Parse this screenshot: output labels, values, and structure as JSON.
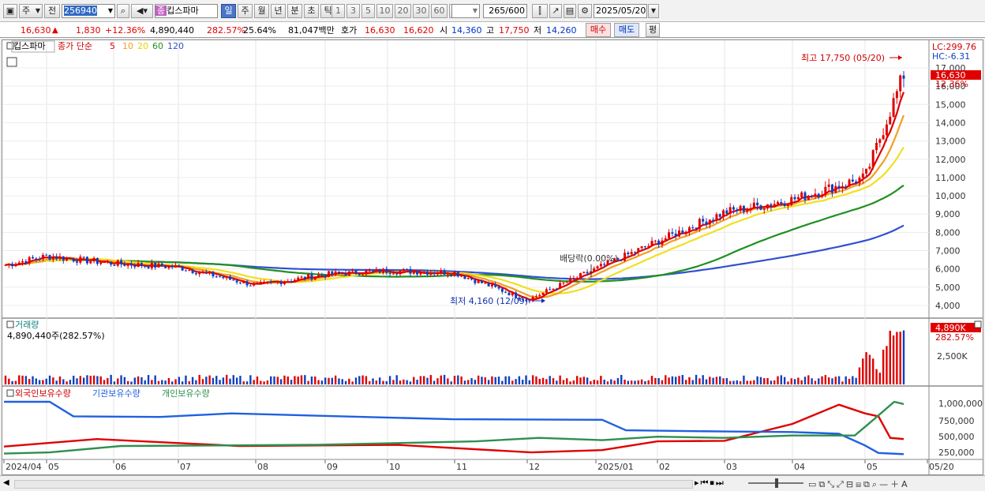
{
  "toolbar": {
    "type_label": "주",
    "scope_label": "전",
    "code": "256940",
    "name_badge": "종",
    "name": "킵스파마",
    "periods": [
      "일",
      "주",
      "월",
      "년",
      "분",
      "초",
      "틱"
    ],
    "intervals": [
      "1",
      "3",
      "5",
      "10",
      "20",
      "30",
      "60",
      "120"
    ],
    "count": "265",
    "count_total": "/600",
    "date": "2025/05/20"
  },
  "quote": {
    "price": "16,630",
    "arrow": "▲",
    "change": "1,830",
    "change_pct": "+12.36%",
    "volume": "4,890,440",
    "vol_ratio": "282.57%",
    "turnover": "25.64%",
    "amount": "81,047백만",
    "hoga_label": "호가",
    "ask": "16,630",
    "bid": "16,620",
    "open_label": "시",
    "open": "14,360",
    "high_label": "고",
    "high": "17,750",
    "low_label": "저",
    "low": "14,260",
    "buy_label": "매수",
    "sell_label": "매도",
    "eval_label": "평"
  },
  "price_panel": {
    "name": "킵스파마",
    "legend_prefix": "종가 단순",
    "ma_periods": [
      "5",
      "10",
      "20",
      "60",
      "120"
    ],
    "lc_label": "LC:299.76",
    "hc_label": "HC:-6.31",
    "current_price_tag": "16,630",
    "current_pct_tag": "12.36%",
    "annot_high": "최고 17,750 (05/20)",
    "annot_low": "최저 4,160 (12/09)",
    "annot_div": "배당락(0.00%)"
  },
  "volume_panel": {
    "title": "거래량",
    "value_text": "4,890,440주(282.57%)",
    "tag_value": "4,890K",
    "tag_pct": "282.57%",
    "tick_label": "2,500K"
  },
  "holdings_panel": {
    "legend": [
      "외국인보유수량",
      "기관보유수량",
      "개인보유수량"
    ],
    "ticks": [
      "1,000,000",
      "750,000",
      "500,000",
      "250,000"
    ]
  },
  "x_axis": [
    "2024/04",
    "05",
    "06",
    "07",
    "08",
    "09",
    "10",
    "11",
    "12",
    "2025/01",
    "02",
    "03",
    "04",
    "05",
    "05/20"
  ],
  "chart_data": {
    "type": "line",
    "price_axis": {
      "ticks": [
        4000,
        5000,
        6000,
        7000,
        8000,
        9000,
        10000,
        11000,
        12000,
        13000,
        14000,
        15000,
        16000,
        17000
      ]
    },
    "price_series": [
      {
        "x": "2024/04",
        "close": 6200
      },
      {
        "x": "05",
        "close": 6700
      },
      {
        "x": "06",
        "close": 6300
      },
      {
        "x": "07",
        "close": 6100
      },
      {
        "x": "08",
        "close": 5100
      },
      {
        "x": "09",
        "close": 5700
      },
      {
        "x": "10",
        "close": 5900
      },
      {
        "x": "11",
        "close": 5800
      },
      {
        "x": "12",
        "close": 4300
      },
      {
        "x": "2025/01",
        "close": 6000
      },
      {
        "x": "02",
        "close": 7500
      },
      {
        "x": "03",
        "close": 9100
      },
      {
        "x": "04",
        "close": 9800
      },
      {
        "x": "05",
        "close": 11000
      },
      {
        "x": "05/20",
        "close": 16630
      }
    ],
    "volume_axis": {
      "ticks": [
        2500
      ]
    },
    "holdings_axis": {
      "ticks": [
        250000,
        500000,
        750000,
        1000000
      ]
    },
    "colors": {
      "ma5": "#e00000",
      "ma10": "#f0a020",
      "ma20": "#f0e020",
      "ma60": "#209020",
      "ma120": "#3050d0",
      "up": "#e00000",
      "down": "#1040c0",
      "foreign": "#e00000",
      "institution": "#2060e0",
      "individual": "#2f8f4f"
    }
  }
}
